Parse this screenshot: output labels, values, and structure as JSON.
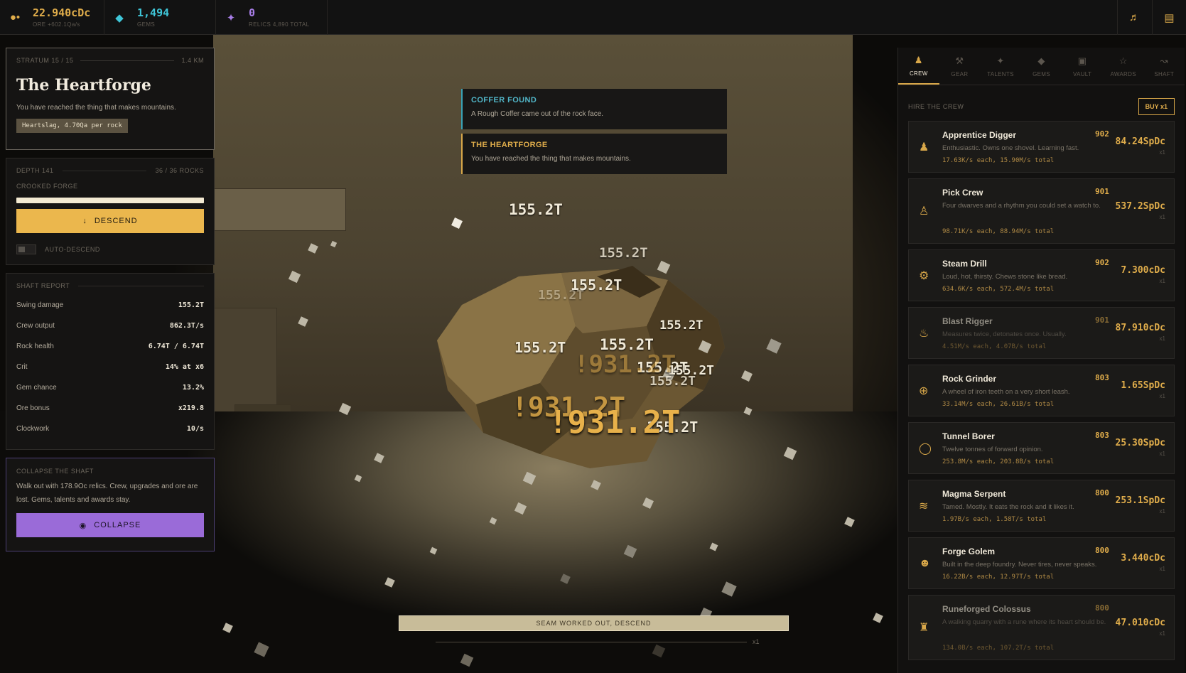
{
  "resources": {
    "ore": {
      "value": "22.940cDc",
      "sub": "ORE +602.1Qa/s",
      "icon": "ore-icon"
    },
    "gems": {
      "value": "1,494",
      "sub": "GEMS",
      "icon": "gem-icon"
    },
    "relics": {
      "value": "0",
      "sub": "RELICS 4,890 TOTAL",
      "icon": "sparkle-icon"
    }
  },
  "colors": {
    "ore": "#e0ad4b",
    "gems": "#3fc6d8",
    "relics": "#a87ee8"
  },
  "stratum": {
    "label": "STRATUM 15 / 15",
    "distance": "1.4 km",
    "title": "The Heartforge",
    "desc": "You have reached the thing that makes mountains.",
    "tag": "Heartslag, 4.70Qa per rock"
  },
  "depth": {
    "label": "DEPTH 141",
    "rocks": "36 / 36 ROCKS",
    "zone": "CROOKED FORGE",
    "progress": 1.0,
    "descend_label": "DESCEND",
    "auto_label": "AUTO-DESCEND",
    "auto_on": false
  },
  "report": {
    "label": "SHAFT REPORT",
    "rows": [
      {
        "k": "Swing damage",
        "v": "155.2T"
      },
      {
        "k": "Crew output",
        "v": "862.3T/s"
      },
      {
        "k": "Rock health",
        "v": "6.74T / 6.74T"
      },
      {
        "k": "Crit",
        "v": "14% at x6"
      },
      {
        "k": "Gem chance",
        "v": "13.2%"
      },
      {
        "k": "Ore bonus",
        "v": "x219.8"
      },
      {
        "k": "Clockwork",
        "v": "10/s"
      }
    ]
  },
  "collapse": {
    "label": "COLLAPSE THE SHAFT",
    "desc": "Walk out with 178.9Oc relics. Crew, upgrades and ore are lost. Gems, talents and awards stay.",
    "button": "COLLAPSE"
  },
  "toasts": [
    {
      "title": "COFFER FOUND",
      "desc": "A Rough Coffer came out of the rock face."
    },
    {
      "title": "THE HEARTFORGE",
      "desc": "You have reached the thing that makes mountains."
    }
  ],
  "hits": [
    {
      "text": "155.2T",
      "kind": "dmg"
    },
    {
      "text": "155.2T",
      "kind": "dmg"
    },
    {
      "text": "155.2T",
      "kind": "dmg"
    },
    {
      "text": "155.2T",
      "kind": "dmg"
    },
    {
      "text": "155.2T",
      "kind": "dmg"
    },
    {
      "text": "155.2T",
      "kind": "dmg"
    },
    {
      "text": "155.2T",
      "kind": "dmg"
    },
    {
      "text": "155.2T",
      "kind": "dmg"
    },
    {
      "text": "155.2T",
      "kind": "dmg"
    },
    {
      "text": "155.2T",
      "kind": "dmg"
    },
    {
      "text": "155.2T",
      "kind": "dmg"
    },
    {
      "text": "!931.2T",
      "kind": "crit"
    },
    {
      "text": "!931.2T",
      "kind": "crit"
    },
    {
      "text": "!931.2T",
      "kind": "crit"
    }
  ],
  "seam": {
    "label": "SEAM WORKED OUT, DESCEND",
    "mult": "x1"
  },
  "tabs": [
    {
      "label": "CREW",
      "icon": "crew-icon",
      "active": true
    },
    {
      "label": "GEAR",
      "icon": "gear-icon",
      "active": false
    },
    {
      "label": "TALENTS",
      "icon": "talents-icon",
      "active": false
    },
    {
      "label": "GEMS",
      "icon": "gem-icon",
      "active": false
    },
    {
      "label": "VAULT",
      "icon": "vault-icon",
      "active": false
    },
    {
      "label": "AWARDS",
      "icon": "award-icon",
      "active": false
    },
    {
      "label": "SHAFT",
      "icon": "shaft-icon",
      "active": false
    }
  ],
  "crew_header": {
    "label": "HIRE THE CREW",
    "buy": "BUY x1"
  },
  "crew": [
    {
      "name": "Apprentice Digger",
      "level": "902",
      "desc": "Enthusiastic. Owns one shovel. Learning fast.",
      "rate": "17.63K/s each, 15.90M/s total",
      "price": "84.24SpDc",
      "qty": "x1",
      "icon": "person-icon",
      "dim": false
    },
    {
      "name": "Pick Crew",
      "level": "901",
      "desc": "Four dwarves and a rhythm you could set a watch to.",
      "rate": "98.71K/s each, 88.94M/s total",
      "price": "537.2SpDc",
      "qty": "x1",
      "icon": "group-icon",
      "dim": false
    },
    {
      "name": "Steam Drill",
      "level": "902",
      "desc": "Loud, hot, thirsty. Chews stone like bread.",
      "rate": "634.6K/s each, 572.4M/s total",
      "price": "7.300cDc",
      "qty": "x1",
      "icon": "cog-icon",
      "dim": false
    },
    {
      "name": "Blast Rigger",
      "level": "901",
      "desc": "Measures twice, detonates once. Usually.",
      "rate": "4.51M/s each, 4.07B/s total",
      "price": "87.910cDc",
      "qty": "x1",
      "icon": "flame-icon",
      "dim": true
    },
    {
      "name": "Rock Grinder",
      "level": "803",
      "desc": "A wheel of iron teeth on a very short leash.",
      "rate": "33.14M/s each, 26.61B/s total",
      "price": "1.65SpDc",
      "qty": "x1",
      "icon": "grinder-icon",
      "dim": false
    },
    {
      "name": "Tunnel Borer",
      "level": "803",
      "desc": "Twelve tonnes of forward opinion.",
      "rate": "253.8M/s each, 203.8B/s total",
      "price": "25.30SpDc",
      "qty": "x1",
      "icon": "ring-icon",
      "dim": false
    },
    {
      "name": "Magma Serpent",
      "level": "800",
      "desc": "Tamed. Mostly. It eats the rock and it likes it.",
      "rate": "1.97B/s each, 1.58T/s total",
      "price": "253.1SpDc",
      "qty": "x1",
      "icon": "waves-icon",
      "dim": false
    },
    {
      "name": "Forge Golem",
      "level": "800",
      "desc": "Built in the deep foundry. Never tires, never speaks.",
      "rate": "16.22B/s each, 12.97T/s total",
      "price": "3.440cDc",
      "qty": "x1",
      "icon": "golem-icon",
      "dim": false
    },
    {
      "name": "Runeforged Colossus",
      "level": "800",
      "desc": "A walking quarry with a rune where its heart should be.",
      "rate": "134.0B/s each, 107.2T/s total",
      "price": "47.010cDc",
      "qty": "x1",
      "icon": "colossus-icon",
      "dim": true
    }
  ]
}
